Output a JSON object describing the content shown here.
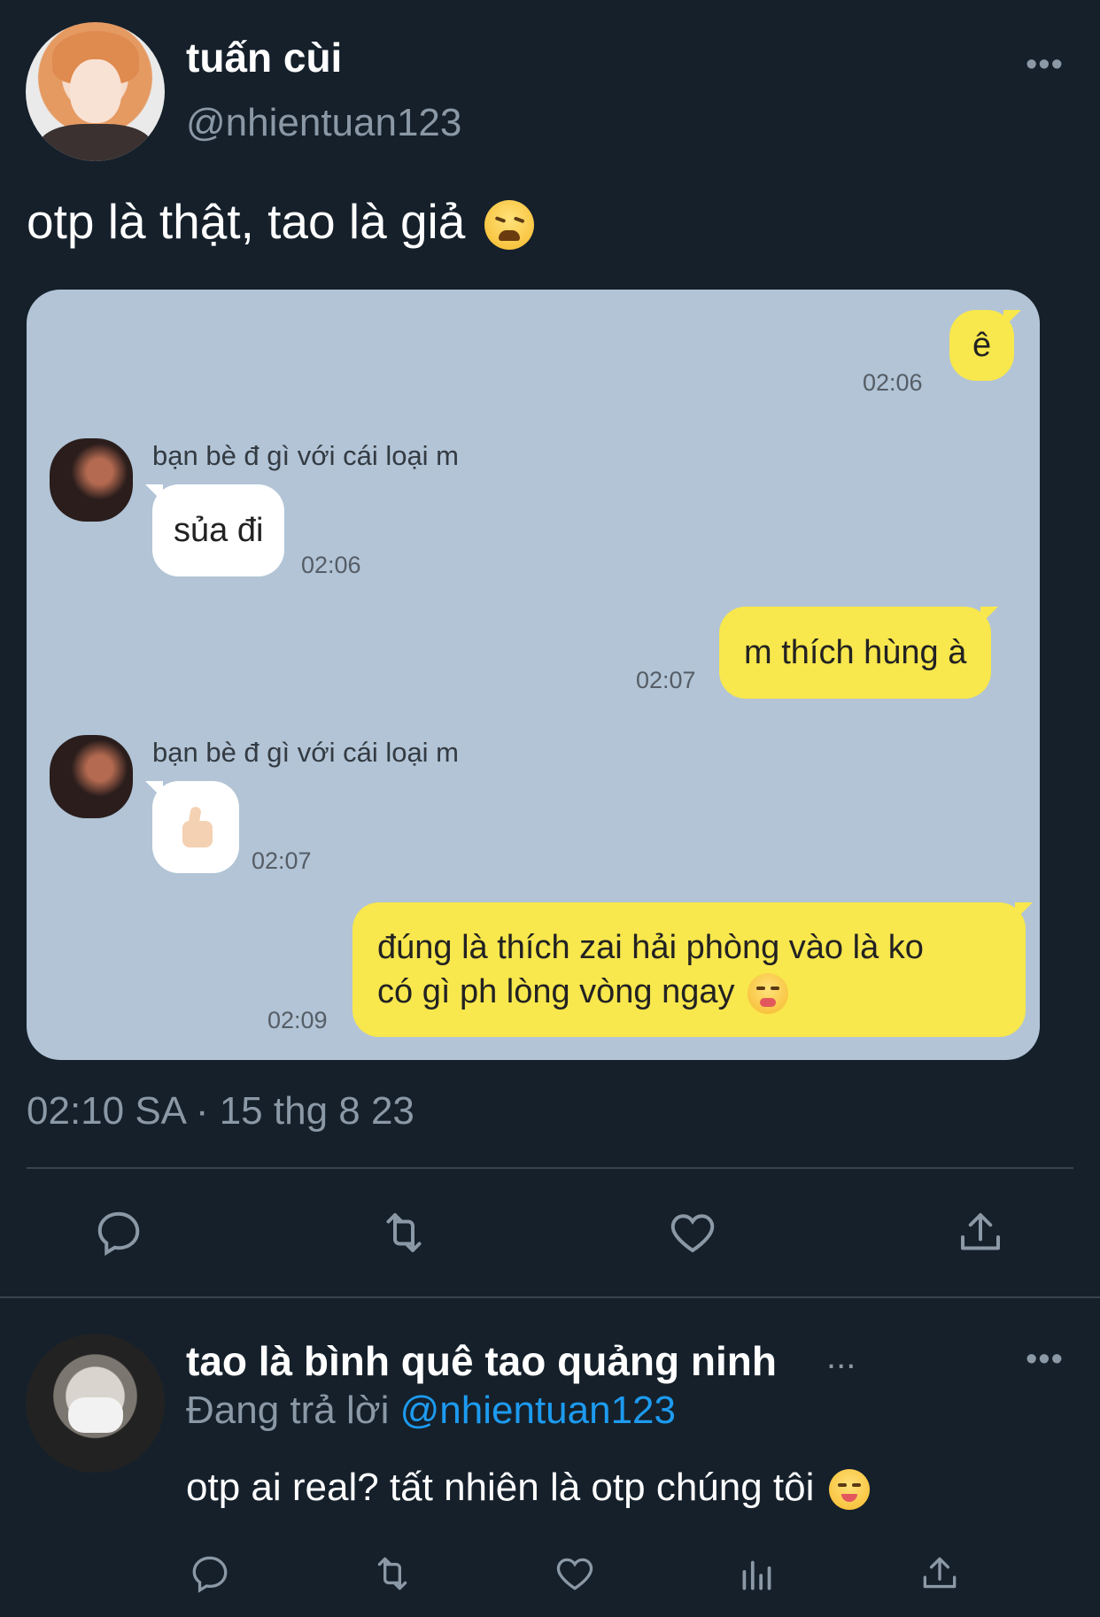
{
  "tweet": {
    "display_name": "tuấn cùi",
    "handle": "@nhientuan123",
    "text": "otp là thật, tao là giả",
    "emoji": "weary-face",
    "timestamp": "02:10 SA · 15 thg 8 23",
    "more_label": "•••"
  },
  "chat": {
    "messages": [
      {
        "from": "me",
        "text": "ê",
        "time": "02:06"
      },
      {
        "from": "them",
        "name": "bạn bè đ gì với cái loại m",
        "text": "sủa đi",
        "time": "02:06"
      },
      {
        "from": "me",
        "text": "m thích hùng à",
        "time": "02:07"
      },
      {
        "from": "them",
        "name": "bạn bè đ gì với cái loại m",
        "sticker": "thumbs-up",
        "time": "02:07"
      },
      {
        "from": "me",
        "text_line1": "đúng là thích zai hải phòng vào là ko",
        "text_line2": "có gì ph lòng vòng ngay",
        "emoji": "winking-face-with-tongue",
        "time": "02:09"
      }
    ]
  },
  "reply": {
    "display_name": "tao là bình quê tao quảng ninh",
    "ellipsis": "...",
    "replying_prefix": "Đang trả lời",
    "replying_handle": "@nhientuan123",
    "text": "otp ai real? tất nhiên là otp chúng tôi",
    "emoji": "face-savoring-food",
    "more_label": "•••"
  },
  "actions": {
    "main": [
      "reply-icon",
      "retweet-icon",
      "like-icon",
      "share-icon"
    ],
    "reply": [
      "reply-icon",
      "retweet-icon",
      "like-icon",
      "analytics-icon",
      "share-icon"
    ]
  }
}
